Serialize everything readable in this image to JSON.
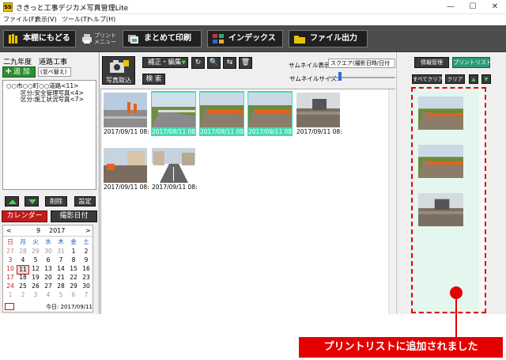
{
  "window": {
    "title": "さきっと工事デジカメ写真管理Lite",
    "icon_text": "SS",
    "controls": [
      "—",
      "☐",
      "✕"
    ]
  },
  "menu": [
    "ファイル(F)",
    "表示(V)",
    "ツール(T)",
    "ヘルプ(H)"
  ],
  "toolbar": {
    "back_label": "本棚にもどる",
    "print_menu_label": "プリント\nメニュー",
    "batch_print_label": "まとめて印刷",
    "index_label": "インデックス",
    "file_output_label": "ファイル出力"
  },
  "left": {
    "project_title": "二九年度　道路工事",
    "add_label": "追 加",
    "sort_label": "(並べ替え)",
    "tree": [
      "○○市○○町○○道路<11>",
      "区分:安全管理写真<4>",
      "区分:施工状況写真<7>"
    ],
    "delete_label": "削除",
    "settings_label": "設定",
    "calendar_tab": "カレンダー",
    "shooting_date_tab": "撮影日付",
    "calendar": {
      "month": "9",
      "year": "2017",
      "prev": "<",
      "next": ">",
      "weekdays": [
        "日",
        "月",
        "火",
        "水",
        "木",
        "金",
        "土"
      ],
      "rows": [
        [
          "27",
          "28",
          "29",
          "30",
          "31",
          "1",
          "2"
        ],
        [
          "3",
          "4",
          "5",
          "6",
          "7",
          "8",
          "9"
        ],
        [
          "10",
          "11",
          "12",
          "13",
          "14",
          "15",
          "16"
        ],
        [
          "17",
          "18",
          "19",
          "20",
          "21",
          "22",
          "23"
        ],
        [
          "24",
          "25",
          "26",
          "27",
          "28",
          "29",
          "30"
        ],
        [
          "1",
          "2",
          "3",
          "4",
          "5",
          "6",
          "7"
        ]
      ],
      "today_label": "今日: 2017/09/11",
      "highlight_day": "11"
    }
  },
  "center": {
    "import_label": "写真取込",
    "edit_label": "補正・編集",
    "search_label": "検 索",
    "thumb_display_label": "サムネイル表示:",
    "thumb_display_value": "スクエア(撮影日時/日付",
    "thumb_size_label": "サムネイルサイズ:",
    "thumb_size_level": 0.15,
    "photos": [
      {
        "caption": "2017/09/11 08:",
        "selected": false,
        "scene": "road-cones"
      },
      {
        "caption": "2017/09/11 08:",
        "selected": true,
        "scene": "curb-grass"
      },
      {
        "caption": "2017/09/11 08:",
        "selected": true,
        "scene": "curb-barrier"
      },
      {
        "caption": "2017/09/11 08:",
        "selected": true,
        "scene": "curb-barrier"
      },
      {
        "caption": "2017/09/11 08:",
        "selected": false,
        "scene": "construction"
      },
      {
        "caption": "2017/09/11 08:",
        "selected": false,
        "scene": "building-site"
      },
      {
        "caption": "2017/09/11 08:",
        "selected": false,
        "scene": "street"
      }
    ]
  },
  "right": {
    "info_tab": "情報管理",
    "printlist_tab": "プリントリスト",
    "select_all_clear": "すべてクリア",
    "clear": "クリア",
    "print_items": 3
  },
  "annotation": {
    "notice": "プリントリストに追加されました",
    "color": "#e40000"
  },
  "colors": {
    "selection": "#4ad8b4",
    "accent_red": "#e40000",
    "toolbar": "#4d4d4d"
  }
}
